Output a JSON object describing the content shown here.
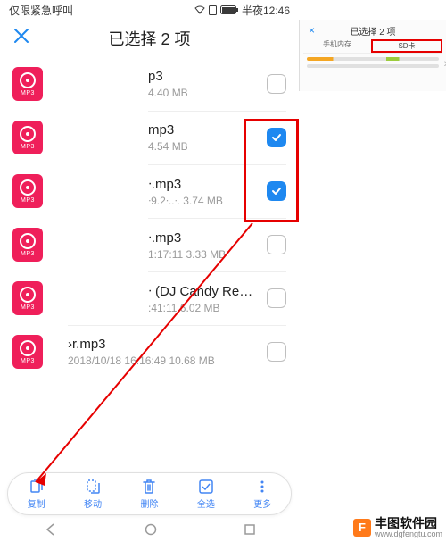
{
  "status": {
    "left": "仅限紧急呼叫",
    "time": "半夜12:46"
  },
  "header": {
    "title": "已选择 2 项"
  },
  "files": [
    {
      "name": "p3",
      "meta": "4.40 MB",
      "checked": false
    },
    {
      "name": "mp3",
      "meta": "4.54 MB",
      "checked": true
    },
    {
      "name": "ᐧ.mp3",
      "meta": "ᐧ9.2ᐧ..ᐧ. 3.74 MB",
      "checked": true
    },
    {
      "name": "ᐧ.mp3",
      "meta": "1:17:11 3.33 MB",
      "checked": false
    },
    {
      "name": "ᐧ (DJ Candy Remix).m…",
      "meta": ":41:11 6.02 MB",
      "checked": false
    },
    {
      "name": "›r.mp3",
      "meta": "2018/10/18 16:16:49 10.68 MB",
      "checked": false
    }
  ],
  "mp3_label": "MP3",
  "toolbar": [
    {
      "label": "复制",
      "icon": "copy"
    },
    {
      "label": "移动",
      "icon": "move"
    },
    {
      "label": "删除",
      "icon": "trash"
    },
    {
      "label": "全选",
      "icon": "select"
    },
    {
      "label": "更多",
      "icon": "more"
    }
  ],
  "annotation": {
    "title": "已选择 2 项",
    "tabs": [
      "手机内存",
      "SD卡"
    ]
  },
  "watermark": {
    "brand": "丰图软件园",
    "url": "www.dgfengtu.com"
  }
}
